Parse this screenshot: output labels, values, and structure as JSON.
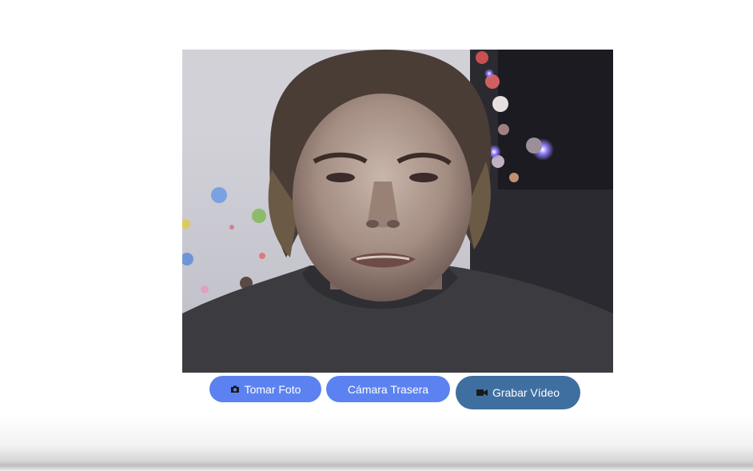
{
  "camera": {
    "feed_description_icon": "webcam-feed"
  },
  "controls": {
    "take_photo": {
      "label": "Tomar Foto",
      "icon": "camera-icon"
    },
    "switch_camera": {
      "label": "Cámara Trasera"
    },
    "record_video": {
      "label": "Grabar Vídeo",
      "icon": "video-camera-icon"
    }
  },
  "colors": {
    "primary_button": "#5b82f0",
    "record_button": "#3f6fa0",
    "button_text": "#ffffff"
  }
}
